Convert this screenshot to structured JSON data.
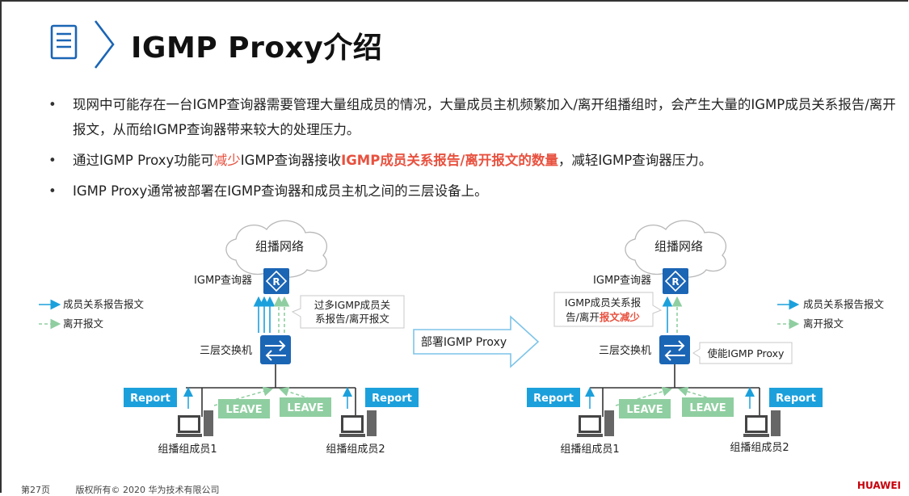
{
  "header": {
    "icon": "document-icon",
    "title": "IGMP Proxy介绍"
  },
  "bullets": {
    "b1": "现网中可能存在一台IGMP查询器需要管理大量组成员的情况，大量成员主机频繁加入/离开组播组时，会产生大量的IGMP成员关系报告/离开报文，从而给IGMP查询器带来较大的处理压力。",
    "b2_part1": "通过IGMP  Proxy功能可",
    "b2_red1": "减少",
    "b2_part2": "IGMP查询器接收",
    "b2_red2": "IGMP成员关系报告/离开报文的数量",
    "b2_part3": "，减轻IGMP查询器压力。",
    "b3": "IGMP Proxy通常被部署在IGMP查询器和成员主机之间的三层设备上。"
  },
  "diagram": {
    "left": {
      "cloud": "组播网络",
      "querier": "IGMP查询器",
      "switch": "三层交换机",
      "callout_l1": "过多IGMP成员关",
      "callout_l2": "系报告/离开报文",
      "legend_report": "成员关系报告报文",
      "legend_leave": "离开报文",
      "report1": "Report",
      "report2": "Report",
      "leave1": "LEAVE",
      "leave2": "LEAVE",
      "member1": "组播组成员1",
      "member2": "组播组成员2"
    },
    "arrow_label": "部署IGMP Proxy",
    "right": {
      "cloud": "组播网络",
      "querier": "IGMP查询器",
      "switch": "三层交换机",
      "callout_l1": "IGMP成员关系报",
      "callout_l2a": "告/离开",
      "callout_l2b": "报文减少",
      "enable": "使能IGMP Proxy",
      "legend_report": "成员关系报告报文",
      "legend_leave": "离开报文",
      "report1": "Report",
      "report2": "Report",
      "leave1": "LEAVE",
      "leave2": "LEAVE",
      "member1": "组播组成员1",
      "member2": "组播组成员2"
    }
  },
  "footer": {
    "page": "第27页",
    "copyright": "版权所有© 2020 华为技术有限公司"
  },
  "logo": "HUAWEI",
  "colors": {
    "accent_blue": "#1b65b5",
    "report_blue": "#1ca0dc",
    "leave_green": "#8fcea0",
    "emphasis_red": "#e8513f"
  }
}
